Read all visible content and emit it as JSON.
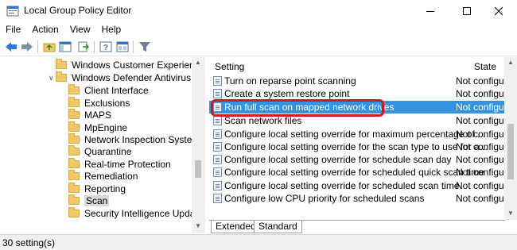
{
  "window": {
    "title": "Local Group Policy Editor"
  },
  "menu": [
    "File",
    "Action",
    "View",
    "Help"
  ],
  "toolbar": {
    "buttons": [
      "back-icon",
      "forward-icon",
      "up-folder-icon",
      "show-hide-tree-icon",
      "export-list-icon",
      "help-icon",
      "properties-icon",
      "filter-icon"
    ]
  },
  "tree": {
    "items": [
      {
        "label": "Windows Customer Experience Imp",
        "level": 1
      },
      {
        "label": "Windows Defender Antivirus",
        "level": 1,
        "expanded": true
      },
      {
        "label": "Client Interface",
        "level": 2
      },
      {
        "label": "Exclusions",
        "level": 2
      },
      {
        "label": "MAPS",
        "level": 2
      },
      {
        "label": "MpEngine",
        "level": 2
      },
      {
        "label": "Network Inspection System",
        "level": 2
      },
      {
        "label": "Quarantine",
        "level": 2
      },
      {
        "label": "Real-time Protection",
        "level": 2
      },
      {
        "label": "Remediation",
        "level": 2
      },
      {
        "label": "Reporting",
        "level": 2
      },
      {
        "label": "Scan",
        "level": 2,
        "selected": true
      },
      {
        "label": "Security Intelligence Updates",
        "level": 2
      }
    ]
  },
  "list": {
    "columns": {
      "setting": "Setting",
      "state": "State"
    },
    "rows": [
      {
        "setting": "Turn on reparse point scanning",
        "state": "Not configure"
      },
      {
        "setting": "Create a system restore point",
        "state": "Not configure"
      },
      {
        "setting": "Run full scan on mapped network drives",
        "state": "Not configure",
        "highlighted": true
      },
      {
        "setting": "Scan network files",
        "state": "Not configure"
      },
      {
        "setting": "Configure local setting override for maximum percentage of ...",
        "state": "Not configure"
      },
      {
        "setting": "Configure local setting override for the scan type to use for a...",
        "state": "Not configure"
      },
      {
        "setting": "Configure local setting override for schedule scan day",
        "state": "Not configure"
      },
      {
        "setting": "Configure local setting override for scheduled quick scan time",
        "state": "Not configure"
      },
      {
        "setting": "Configure local setting override for scheduled scan time",
        "state": "Not configure"
      },
      {
        "setting": "Configure low CPU priority for scheduled scans",
        "state": "Not configure"
      }
    ]
  },
  "tabs": [
    "Extended",
    "Standard"
  ],
  "status": "30 setting(s)",
  "colors": {
    "selection": "#3393df",
    "callout": "#d01a1a"
  }
}
